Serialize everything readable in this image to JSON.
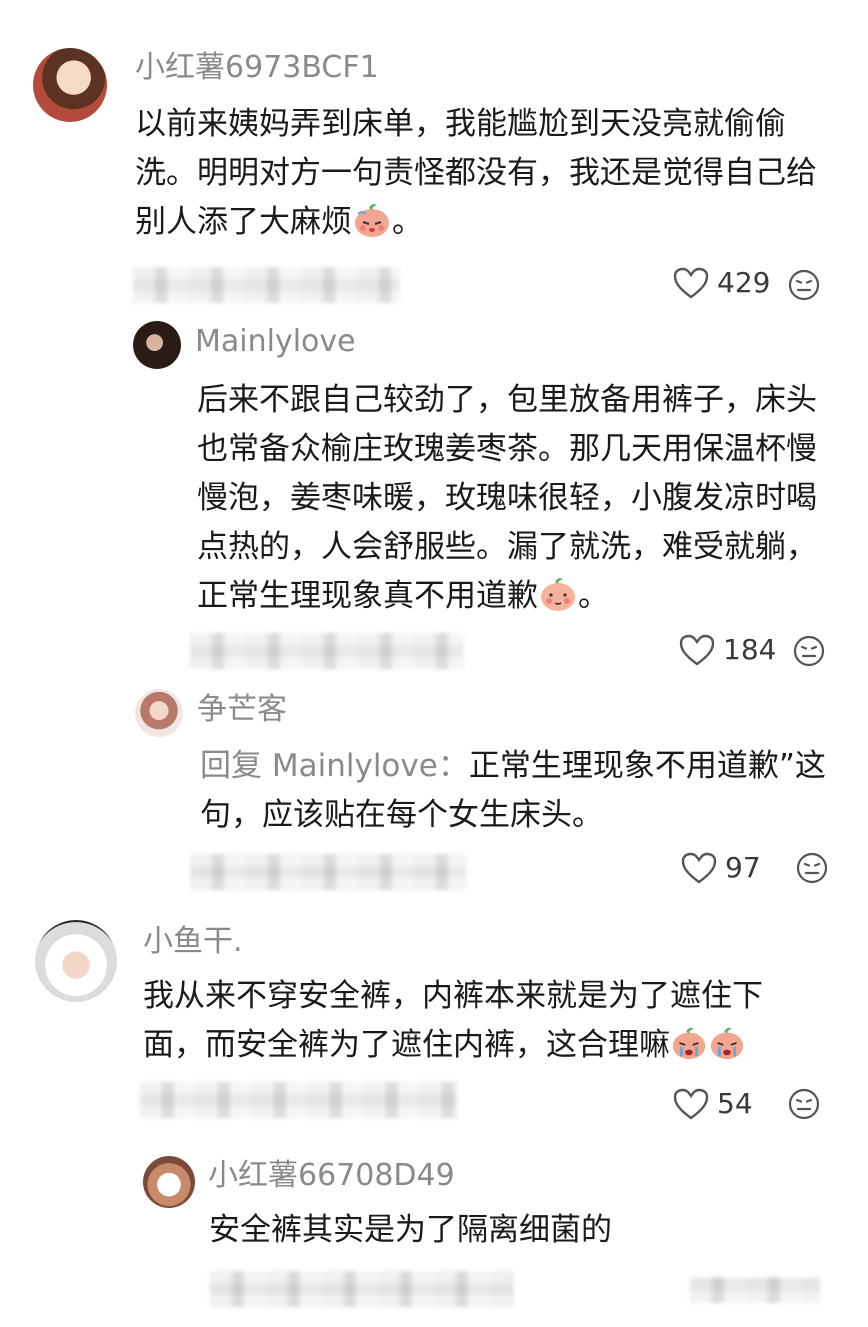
{
  "comments": [
    {
      "username": "小红薯6973BCF1",
      "text": "以前来姨妈弄到床单，我能尴尬到天没亮就偷偷洗。明明对方一句责怪都没有，我还是觉得自己给别人添了大麻烦",
      "emoji": "sad-peach-icon",
      "text_suffix": "。",
      "likes": "429"
    },
    {
      "username": "Mainlylove",
      "text": "后来不跟自己较劲了，包里放备用裤子，床头也常备众榆庄玫瑰姜枣茶。那几天用保温杯慢慢泡，姜枣味暖，玫瑰味很轻，小腹发凉时喝点热的，人会舒服些。漏了就洗，难受就躺，正常生理现象真不用道歉",
      "emoji": "shy-peach-icon",
      "text_suffix": "。",
      "likes": "184"
    },
    {
      "username": "争芒客",
      "reply_prefix": "回复 Mainlylove：",
      "text": "正常生理现象不用道歉”这句，应该贴在每个女生床头。",
      "likes": "97"
    },
    {
      "username": "小鱼干.",
      "text": "我从来不穿安全裤，内裤本来就是为了遮住下面，而安全裤为了遮住内裤，这合理嘛",
      "emoji": "crying-peach-icon",
      "likes": "54"
    },
    {
      "username": "小红薯66708D49",
      "text": "安全裤其实是为了隔离细菌的"
    }
  ],
  "colors": {
    "username": "#8a8a8a",
    "text": "#1a1a1a",
    "icon": "#555555",
    "peach": "#f3a58f"
  }
}
